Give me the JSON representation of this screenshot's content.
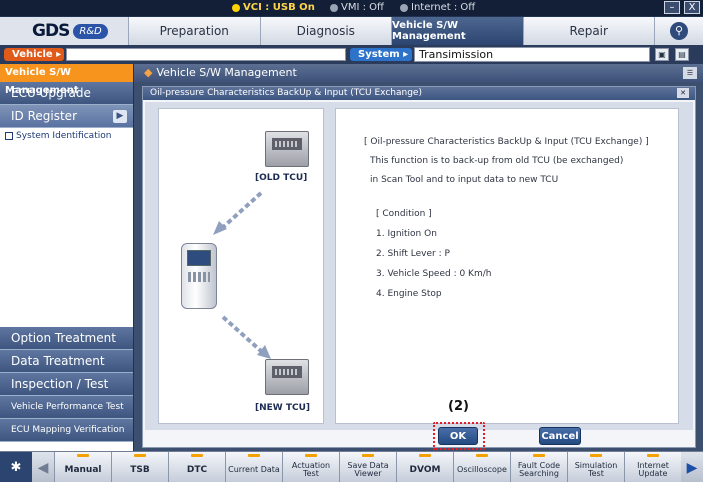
{
  "status": {
    "vci": "VCI : USB On",
    "vmi": "VMI : Off",
    "internet": "Internet : Off"
  },
  "window": {
    "minimize": "–",
    "close": "X"
  },
  "logo": {
    "gds": "GDS",
    "rd": "R&D"
  },
  "nav": {
    "tabs": [
      {
        "label": "Preparation",
        "active": false
      },
      {
        "label": "Diagnosis",
        "active": false
      },
      {
        "label": "Vehicle S/W Management",
        "active": true
      },
      {
        "label": "Repair",
        "active": false
      }
    ],
    "search_icon": "search-icon"
  },
  "vehicle_bar": {
    "vehicle_label": "Vehicle",
    "vehicle_value": "",
    "system_label": "System",
    "system_value": "Transimission"
  },
  "sidebar": {
    "header": "Vehicle S/W Management",
    "items_top": [
      {
        "label": "ECU Upgrade",
        "active": false
      },
      {
        "label": "ID Register",
        "active": true
      }
    ],
    "subitem": "System Identification",
    "items_bottom": [
      {
        "label": "Option Treatment"
      },
      {
        "label": "Data Treatment"
      },
      {
        "label": "Inspection / Test"
      },
      {
        "label": "Vehicle Performance Test"
      },
      {
        "label": "ECU Mapping Verification"
      }
    ]
  },
  "main": {
    "title": "Vehicle S/W Management",
    "dialog": {
      "title": "Oil-pressure Characteristics BackUp & Input (TCU Exchange)",
      "old_tcu": "[OLD TCU]",
      "new_tcu": "[NEW TCU]",
      "info_lines": [
        "[ Oil-pressure Characteristics BackUp & Input (TCU Exchange) ]",
        "This function is to back-up from old TCU (be exchanged)",
        "in Scan Tool and to input data to new TCU",
        "[ Condition ]",
        "1. Ignition On",
        "2. Shift Lever : P",
        "3. Vehicle Speed : 0 Km/h",
        "4. Engine Stop"
      ],
      "annotation": "(2)",
      "ok_label": "OK",
      "cancel_label": "Cancel"
    }
  },
  "toolbar": {
    "items": [
      "Manual",
      "TSB",
      "DTC",
      "Current Data",
      "Actuation Test",
      "Save Data Viewer",
      "DVOM",
      "Oscilloscope",
      "Fault Code Searching",
      "Simulation Test",
      "Internet Update"
    ]
  }
}
